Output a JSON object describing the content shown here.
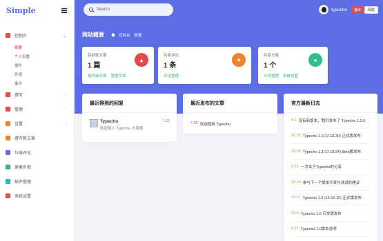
{
  "brand": {
    "name": "Simple"
  },
  "sidebar": {
    "items": [
      {
        "label": "控制台",
        "icon": "dashboard-icon",
        "color": "#e24b4b",
        "expanded": true,
        "children": [
          {
            "label": "概要",
            "active": true
          },
          {
            "label": "个人设置"
          },
          {
            "label": "插件"
          },
          {
            "label": "外观"
          },
          {
            "label": "备份"
          }
        ]
      },
      {
        "label": "撰写",
        "icon": "edit-icon",
        "color": "#e24b4b"
      },
      {
        "label": "管理",
        "icon": "manage-icon",
        "color": "#e24b4b"
      },
      {
        "label": "设置",
        "icon": "settings-icon",
        "color": "#f0822e"
      },
      {
        "label": "撰写新文章",
        "icon": "new-post-icon",
        "color": "#f0822e"
      },
      {
        "label": "垃圾评论",
        "icon": "spam-icon",
        "color": "#5c6de6"
      },
      {
        "label": "更换外观",
        "icon": "theme-icon",
        "color": "#3bb56f"
      },
      {
        "label": "插件管理",
        "icon": "plugin-icon",
        "color": "#2bb5c4"
      },
      {
        "label": "系统设置",
        "icon": "system-icon",
        "color": "#e24b4b"
      }
    ]
  },
  "header": {
    "search_placeholder": "Search",
    "username": "typecho",
    "logout_label": "登出",
    "site_label": "网站"
  },
  "page": {
    "title": "网站概要",
    "breadcrumb": [
      "控制台",
      "概要"
    ]
  },
  "stats": [
    {
      "label": "already-posts",
      "text": "目前有文章",
      "value": "1 篇",
      "links": [
        "撰写新文章",
        "管理文章"
      ],
      "icon": "thumb-up-icon",
      "color": "#e24b4b"
    },
    {
      "label": "comments",
      "text": "共有评论",
      "value": "1 条",
      "links": [
        "评论管理"
      ],
      "icon": "like-icon",
      "color": "#f0822e"
    },
    {
      "label": "categories",
      "text": "共有分类",
      "value": "1 个",
      "links": [
        "分类管理",
        "系统设置"
      ],
      "icon": "chat-icon",
      "color": "#2ec08a"
    }
  ],
  "recent_comments": {
    "title": "最近得到的回复",
    "items": [
      {
        "name": "Typecho",
        "text": "欢迎加入 Typecho 大家族",
        "date": "7.25"
      }
    ]
  },
  "recent_posts": {
    "title": "最近发布的文章",
    "items": [
      {
        "date": "7.25",
        "title": "欢迎使用 Typecho"
      }
    ]
  },
  "official_log": {
    "title": "官方最新日志",
    "items": [
      {
        "date": "4.1",
        "title": "没有新版本，我们发布了 Typecho 1.2.0"
      },
      {
        "date": "10.25",
        "title": "Typecho 1.1(17.10.30) 正式版发布"
      },
      {
        "date": "10.26",
        "title": "Typecho 1.1(17.10.24) Beta版发布"
      },
      {
        "date": "8.21",
        "title": "一次关于Typecho的分享"
      },
      {
        "date": "10.14",
        "title": "参与下一个版本开发与测试的建议"
      },
      {
        "date": "10.11",
        "title": "Typecho 1.0 (14.10.10) 正式版发布"
      },
      {
        "date": "10.9",
        "title": "Typecho 1.0 开发版发布"
      },
      {
        "date": "5.27",
        "title": "Typecho 1.0版本说明"
      }
    ]
  }
}
